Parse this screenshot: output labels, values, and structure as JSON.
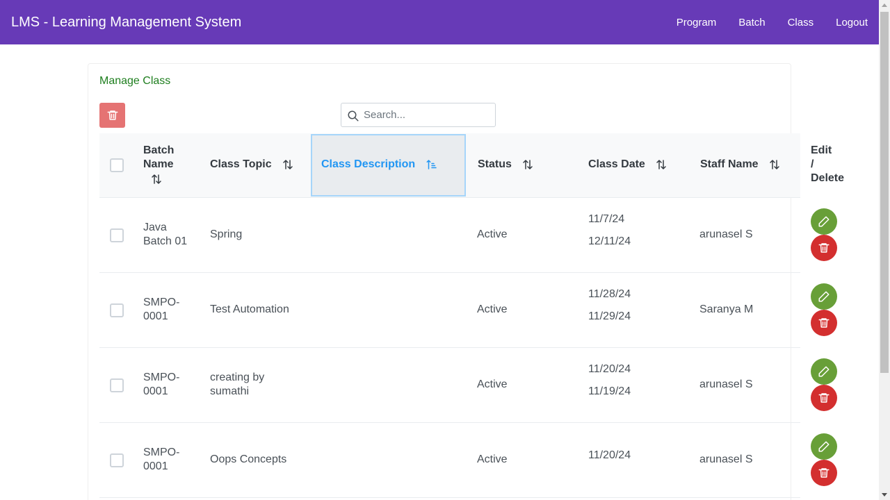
{
  "app": {
    "title": "LMS - Learning Management System"
  },
  "nav": {
    "items": [
      "Program",
      "Batch",
      "Class",
      "Logout"
    ]
  },
  "page": {
    "title": "Manage Class"
  },
  "search": {
    "placeholder": "Search..."
  },
  "table": {
    "headers": {
      "batch_name_1": "Batch",
      "batch_name_2": "Name",
      "class_topic": "Class Topic",
      "class_description": "Class Description",
      "status": "Status",
      "class_date": "Class Date",
      "staff_name": "Staff Name",
      "edit_delete_1": "Edit",
      "edit_delete_2": "/",
      "edit_delete_3": "Delete"
    },
    "rows": [
      {
        "batch_1": "Java",
        "batch_2": "Batch 01",
        "topic_1": "Spring",
        "topic_2": "",
        "description": "",
        "status": "Active",
        "date_1": "11/7/24",
        "date_2": "12/11/24",
        "staff": "arunasel S"
      },
      {
        "batch_1": "SMPO-",
        "batch_2": "0001",
        "topic_1": "Test Automation",
        "topic_2": "",
        "description": "",
        "status": "Active",
        "date_1": "11/28/24",
        "date_2": "11/29/24",
        "staff": "Saranya M"
      },
      {
        "batch_1": "SMPO-",
        "batch_2": "0001",
        "topic_1": "creating by",
        "topic_2": "sumathi",
        "description": "",
        "status": "Active",
        "date_1": "11/20/24",
        "date_2": "11/19/24",
        "staff": "arunasel S"
      },
      {
        "batch_1": "SMPO-",
        "batch_2": "0001",
        "topic_1": "Oops Concepts",
        "topic_2": "",
        "description": "",
        "status": "Active",
        "date_1": "11/20/24",
        "date_2": "",
        "staff": "arunasel S"
      }
    ]
  },
  "colors": {
    "topbar": "#673ab7",
    "title_green": "#1e7e1e",
    "edit_green": "#689f38",
    "delete_red": "#d32f2f",
    "bulk_delete": "#e57373",
    "active_sort": "#2196f3"
  },
  "icons": {
    "search": "search-icon",
    "sort": "sort-icon",
    "sort_asc": "sort-ascending-icon",
    "edit": "pencil-icon",
    "delete": "trash-icon"
  }
}
